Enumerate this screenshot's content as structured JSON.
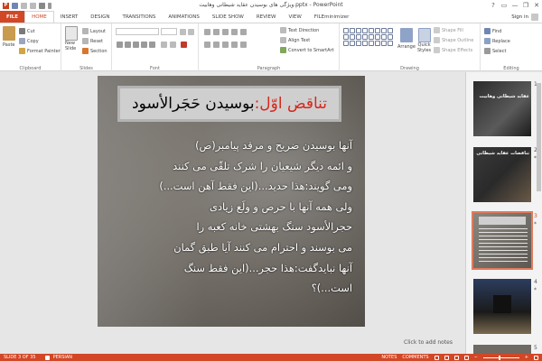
{
  "window": {
    "title": "ویژگی های بوسیدن عقاید شیطانی وهابیت.pptx - PowerPoint",
    "help": "?",
    "ribbon_display": "▭",
    "minimize": "—",
    "restore": "❐",
    "close": "✕"
  },
  "tabs": [
    "FILE",
    "HOME",
    "INSERT",
    "DESIGN",
    "TRANSITIONS",
    "ANIMATIONS",
    "SLIDE SHOW",
    "REVIEW",
    "VIEW",
    "FILEminimizer"
  ],
  "active_tab": "HOME",
  "signin": "Sign in",
  "ribbon": {
    "clipboard": {
      "label": "Clipboard",
      "paste": "Paste",
      "cut": "Cut",
      "copy": "Copy",
      "format_painter": "Format Painter"
    },
    "slides": {
      "label": "Slides",
      "new_slide": "New",
      "new_slide2": "Slide",
      "layout": "Layout",
      "reset": "Reset",
      "section": "Section"
    },
    "font": {
      "label": "Font"
    },
    "paragraph": {
      "label": "Paragraph",
      "text_direction": "Text Direction",
      "align_text": "Align Text",
      "convert_smartart": "Convert to SmartArt"
    },
    "drawing": {
      "label": "Drawing",
      "arrange": "Arrange",
      "quick_styles": "Quick",
      "quick_styles2": "Styles",
      "shape_fill": "Shape Fill",
      "shape_outline": "Shape Outline",
      "shape_effects": "Shape Effects"
    },
    "editing": {
      "label": "Editing",
      "find": "Find",
      "replace": "Replace",
      "select": "Select"
    }
  },
  "slide": {
    "title_part1": "تناقض اوّل:",
    "title_part2": " بوسیدن حَجَرالأسود",
    "body_lines": [
      "آنها بوسیدن ضریح و مرقد پیامبر(ص)",
      "و ائمه دیگر شیعیان را شرک تلقّی می کنند",
      "ومی گویند:هذا حدید...(این فقط آهن است...)",
      "ولی همه آنها با حرص و ولَع زیادی",
      "حجرالأسود سنگ بهشتی خانه کعبه را",
      "می بوسند و احترام می کنند آیا طبق گمان",
      "آنها نبایدگفت:هذا حجر...(این فقط سنگ",
      "است...)؟"
    ]
  },
  "notes_placeholder": "Click to add notes",
  "thumbnails": [
    {
      "num": "1",
      "star": "",
      "title": "عقاید شیطانی وهابیت"
    },
    {
      "num": "2",
      "star": "*",
      "title": "تناقضات عقاید شیطانی"
    },
    {
      "num": "3",
      "star": "*",
      "title": ""
    },
    {
      "num": "4",
      "star": "*",
      "title": ""
    },
    {
      "num": "5",
      "star": "",
      "title": ""
    }
  ],
  "status": {
    "slide_info": "SLIDE 3 OF 35",
    "language": "PERSIAN",
    "notes": "NOTES",
    "comments": "COMMENTS",
    "zoom_minus": "−",
    "zoom_plus": "+",
    "zoom_level": 0.45
  },
  "colors": {
    "accent": "#d24726",
    "title_red": "#d7281c",
    "selected_thumb": "#e07b5c"
  }
}
